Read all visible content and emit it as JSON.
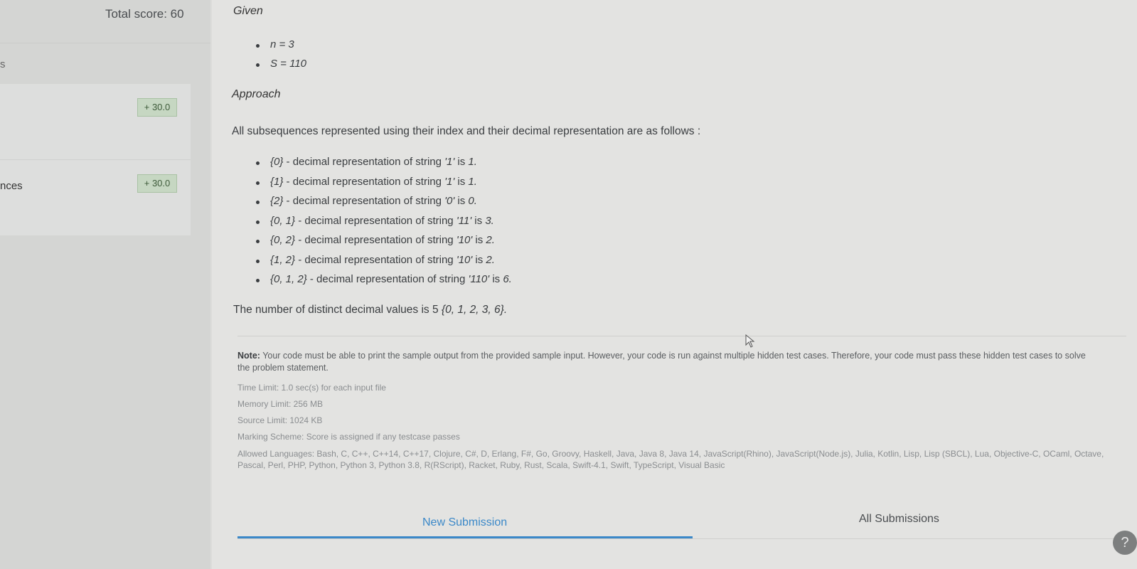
{
  "sidebar": {
    "total_score": "Total score: 60",
    "partial_text_top": "s",
    "rows": [
      {
        "label": "",
        "score": "+ 30.0"
      },
      {
        "label": "nces",
        "score": "+ 30.0"
      }
    ]
  },
  "problem": {
    "given_title": "Given",
    "given_items": [
      "n = 3",
      "S = 110"
    ],
    "approach_title": "Approach",
    "approach_intro": "All subsequences represented using their index and their decimal representation are as follows :",
    "subsequences": [
      {
        "idx": "{0}",
        "mid": " - decimal representation of string ",
        "str": "'1'",
        "is": " is ",
        "val": "1."
      },
      {
        "idx": "{1}",
        "mid": " - decimal representation of string ",
        "str": "'1'",
        "is": " is ",
        "val": "1."
      },
      {
        "idx": "{2}",
        "mid": " - decimal representation of string ",
        "str": "'0'",
        "is": " is ",
        "val": "0."
      },
      {
        "idx": "{0, 1}",
        "mid": " - decimal representation of string ",
        "str": "'11'",
        "is": " is ",
        "val": "3."
      },
      {
        "idx": "{0, 2}",
        "mid": " - decimal representation of string ",
        "str": "'10'",
        "is": " is ",
        "val": "2."
      },
      {
        "idx": "{1, 2}",
        "mid": " - decimal representation of string ",
        "str": "'10'",
        "is": " is ",
        "val": "2."
      },
      {
        "idx": "{0, 1, 2}",
        "mid": " - decimal representation of string ",
        "str": "'110'",
        "is": " is ",
        "val": "6."
      }
    ],
    "result_text": "The number of distinct decimal values is 5 ",
    "result_set": "{0, 1, 2, 3, 6}."
  },
  "note": {
    "label": "Note:",
    "text": " Your code must be able to print the sample output from the provided sample input. However, your code is run against multiple hidden test cases. Therefore, your code must pass these hidden test cases to solve the problem statement."
  },
  "limits": {
    "time": "Time Limit: 1.0 sec(s) for each input file",
    "memory": "Memory Limit: 256 MB",
    "source": "Source Limit: 1024 KB",
    "marking": "Marking Scheme: Score is assigned if any testcase passes",
    "languages": "Allowed Languages: Bash, C, C++, C++14, C++17, Clojure, C#, D, Erlang, F#, Go, Groovy, Haskell, Java, Java 8, Java 14, JavaScript(Rhino), JavaScript(Node.js), Julia, Kotlin, Lisp, Lisp (SBCL), Lua, Objective-C, OCaml, Octave, Pascal, Perl, PHP, Python, Python 3, Python 3.8, R(RScript), Racket, Ruby, Rust, Scala, Swift-4.1, Swift, TypeScript, Visual Basic"
  },
  "tabs": {
    "new_submission": "New Submission",
    "all_submissions": "All Submissions"
  },
  "help": {
    "icon": "?"
  },
  "colors": {
    "accent": "#3b88c8",
    "badge_bg": "#c6d7c2",
    "topbar": "#2f5f9e"
  }
}
